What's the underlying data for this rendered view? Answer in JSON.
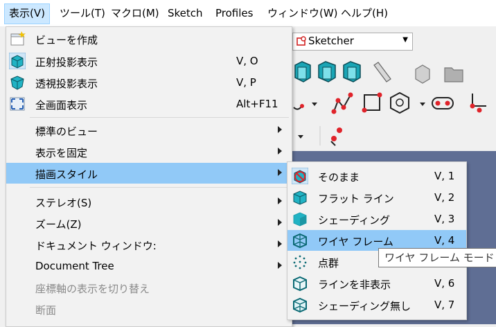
{
  "menubar": {
    "items": [
      {
        "label": "表示(V)",
        "active": true
      },
      {
        "label": "ツール(T)"
      },
      {
        "label": "マクロ(M)"
      },
      {
        "label": "Sketch"
      },
      {
        "label": "Profiles"
      },
      {
        "label": "ウィンドウ(W)"
      },
      {
        "label": "ヘルプ(H)"
      }
    ]
  },
  "workbench_combo": {
    "value": "Sketcher"
  },
  "view_menu": {
    "items": [
      {
        "label": "ビューを作成",
        "icon": "create-view-icon"
      },
      {
        "label": "正射投影表示",
        "shortcut": "V, O",
        "icon": "orthographic-icon"
      },
      {
        "label": "透視投影表示",
        "shortcut": "V, P",
        "icon": "perspective-icon"
      },
      {
        "label": "全画面表示",
        "shortcut": "Alt+F11",
        "icon": "fullscreen-icon"
      },
      {
        "label": "標準のビュー",
        "submenu": true
      },
      {
        "label": "表示を固定",
        "submenu": true
      },
      {
        "label": "描画スタイル",
        "submenu": true,
        "highlighted": true
      },
      {
        "label": "ステレオ(S)",
        "submenu": true
      },
      {
        "label": "ズーム(Z)",
        "submenu": true
      },
      {
        "label": "ドキュメント ウィンドウ:",
        "submenu": true
      },
      {
        "label": "Document Tree",
        "submenu": true
      },
      {
        "label": "座標軸の表示を切り替え",
        "disabled": true
      },
      {
        "label": "断面",
        "disabled": true
      }
    ]
  },
  "draw_style_submenu": {
    "items": [
      {
        "label": "そのまま",
        "shortcut": "V, 1",
        "icon": "as-is-icon"
      },
      {
        "label": "フラット ライン",
        "shortcut": "V, 2",
        "icon": "flat-lines-icon"
      },
      {
        "label": "シェーディング",
        "shortcut": "V, 3",
        "icon": "shaded-icon"
      },
      {
        "label": "ワイヤ フレーム",
        "shortcut": "V, 4",
        "icon": "wireframe-icon",
        "highlighted": true
      },
      {
        "label": "点群",
        "shortcut": "",
        "icon": "points-icon"
      },
      {
        "label": "ラインを非表示",
        "shortcut": "V, 6",
        "icon": "hidden-line-icon"
      },
      {
        "label": "シェーディング無し",
        "shortcut": "V, 7",
        "icon": "no-shading-icon"
      }
    ]
  },
  "tooltip": {
    "text": "ワイヤ フレーム モード"
  },
  "colors": {
    "highlight": "#91c9f7",
    "menubar_active": "#cce8ff",
    "cube": "#1fb5c4",
    "red": "#e0232a"
  }
}
